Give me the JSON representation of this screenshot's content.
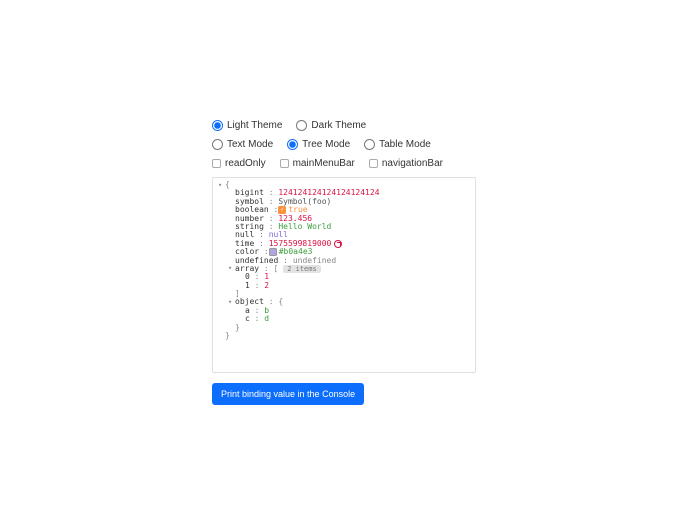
{
  "theme": {
    "options": [
      {
        "value": "light",
        "label": "Light Theme",
        "checked": true
      },
      {
        "value": "dark",
        "label": "Dark Theme",
        "checked": false
      }
    ]
  },
  "mode": {
    "options": [
      {
        "value": "text",
        "label": "Text Mode",
        "checked": false
      },
      {
        "value": "tree",
        "label": "Tree Mode",
        "checked": true
      },
      {
        "value": "table",
        "label": "Table Mode",
        "checked": false
      }
    ]
  },
  "flags": {
    "readOnly": {
      "label": "readOnly",
      "checked": false
    },
    "mainMenuBar": {
      "label": "mainMenuBar",
      "checked": false
    },
    "navigationBar": {
      "label": "navigationBar",
      "checked": false
    }
  },
  "json": {
    "open": "{",
    "close": "}",
    "colon": " : ",
    "props": {
      "bigint": {
        "key": "bigint",
        "value": "124124124124124124124"
      },
      "symbol": {
        "key": "symbol",
        "value": "Symbol(foo)"
      },
      "boolean": {
        "key": "boolean",
        "value": "true"
      },
      "number": {
        "key": "number",
        "value": "123.456"
      },
      "string": {
        "key": "string",
        "value": "Hello World"
      },
      "null": {
        "key": "null",
        "value": "null"
      },
      "time": {
        "key": "time",
        "value": "1575599819000"
      },
      "color": {
        "key": "color",
        "value": "#b0a4e3"
      },
      "undefined": {
        "key": "undefined",
        "value": "undefined"
      },
      "array": {
        "key": "array",
        "open": "[",
        "close": "]",
        "pill": "2 items",
        "items": [
          {
            "key": "0",
            "value": "1"
          },
          {
            "key": "1",
            "value": "2"
          }
        ]
      },
      "object": {
        "key": "object",
        "open": "{",
        "close": "}",
        "items": [
          {
            "key": "a",
            "value": "b"
          },
          {
            "key": "c",
            "value": "d"
          }
        ]
      }
    }
  },
  "button": {
    "label": "Print binding value in the Console"
  }
}
